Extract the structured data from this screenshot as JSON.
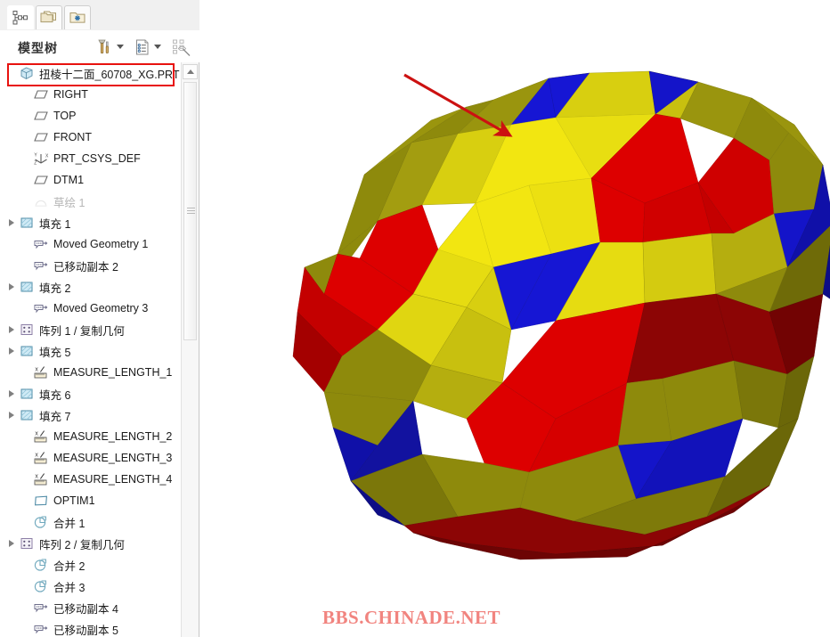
{
  "window": {
    "accent_red": "#e8120f",
    "panel_bg": "#f3f3f3"
  },
  "tabs": [
    {
      "id": "model-tree",
      "icon": "model-tree-icon",
      "label": "",
      "active": true
    },
    {
      "id": "folders",
      "icon": "folder-stack-icon",
      "label": "",
      "active": false
    },
    {
      "id": "favorites",
      "icon": "folder-star-icon",
      "label": "",
      "active": false
    }
  ],
  "tree_header": {
    "title": "模型树",
    "icons": [
      {
        "name": "settings-tools-icon"
      },
      {
        "name": "chevron-down-icon"
      },
      {
        "name": "list-options-icon"
      },
      {
        "name": "chevron-down-icon"
      },
      {
        "name": "filter-tree-icon"
      }
    ]
  },
  "tree": {
    "highlighted_item": "扭棱十二面_60708_XG.PRT",
    "items": [
      {
        "label": "扭棱十二面_60708_XG.PRT",
        "icon": "part-cube-icon",
        "level": 0,
        "expander": false,
        "dim": false,
        "highlight": true
      },
      {
        "label": "RIGHT",
        "icon": "datum-plane-icon",
        "level": 1,
        "expander": false,
        "dim": false
      },
      {
        "label": "TOP",
        "icon": "datum-plane-icon",
        "level": 1,
        "expander": false,
        "dim": false
      },
      {
        "label": "FRONT",
        "icon": "datum-plane-icon",
        "level": 1,
        "expander": false,
        "dim": false
      },
      {
        "label": "PRT_CSYS_DEF",
        "icon": "coord-system-icon",
        "level": 1,
        "expander": false,
        "dim": false
      },
      {
        "label": "DTM1",
        "icon": "datum-plane-icon",
        "level": 1,
        "expander": false,
        "dim": false
      },
      {
        "label": "草绘 1",
        "icon": "sketch-icon",
        "level": 1,
        "expander": false,
        "dim": true
      },
      {
        "label": "填充 1",
        "icon": "fill-surface-icon",
        "level": 1,
        "expander": true,
        "dim": false
      },
      {
        "label": "Moved Geometry 1",
        "icon": "moved-geometry-icon",
        "level": 1,
        "expander": false,
        "dim": false
      },
      {
        "label": "已移动副本 2",
        "icon": "moved-geometry-icon",
        "level": 1,
        "expander": false,
        "dim": false
      },
      {
        "label": "填充 2",
        "icon": "fill-surface-icon",
        "level": 1,
        "expander": true,
        "dim": false
      },
      {
        "label": "Moved Geometry 3",
        "icon": "moved-geometry-icon",
        "level": 1,
        "expander": false,
        "dim": false
      },
      {
        "label": "阵列 1 / 复制几何",
        "icon": "pattern-icon",
        "level": 1,
        "expander": true,
        "dim": false
      },
      {
        "label": "填充 5",
        "icon": "fill-surface-icon",
        "level": 1,
        "expander": true,
        "dim": false
      },
      {
        "label": "MEASURE_LENGTH_1",
        "icon": "measure-length-icon",
        "level": 1,
        "expander": false,
        "dim": false
      },
      {
        "label": "填充 6",
        "icon": "fill-surface-icon",
        "level": 1,
        "expander": true,
        "dim": false
      },
      {
        "label": "填充 7",
        "icon": "fill-surface-icon",
        "level": 1,
        "expander": true,
        "dim": false
      },
      {
        "label": "MEASURE_LENGTH_2",
        "icon": "measure-length-icon",
        "level": 1,
        "expander": false,
        "dim": false
      },
      {
        "label": "MEASURE_LENGTH_3",
        "icon": "measure-length-icon",
        "level": 1,
        "expander": false,
        "dim": false
      },
      {
        "label": "MEASURE_LENGTH_4",
        "icon": "measure-length-icon",
        "level": 1,
        "expander": false,
        "dim": false
      },
      {
        "label": "OPTIM1",
        "icon": "quilt-icon",
        "level": 1,
        "expander": false,
        "dim": false
      },
      {
        "label": "合并 1",
        "icon": "merge-icon",
        "level": 1,
        "expander": false,
        "dim": false
      },
      {
        "label": "阵列 2 / 复制几何",
        "icon": "pattern-icon",
        "level": 1,
        "expander": true,
        "dim": false
      },
      {
        "label": "合并 2",
        "icon": "merge-icon",
        "level": 1,
        "expander": false,
        "dim": false
      },
      {
        "label": "合并 3",
        "icon": "merge-icon",
        "level": 1,
        "expander": false,
        "dim": false
      },
      {
        "label": "已移动副本 4",
        "icon": "moved-geometry-icon",
        "level": 1,
        "expander": false,
        "dim": false
      },
      {
        "label": "已移动副本 5",
        "icon": "moved-geometry-icon",
        "level": 1,
        "expander": false,
        "dim": false
      }
    ]
  },
  "scrollbar": {
    "up_button": "scroll-up-icon",
    "thumb_name": "scroll-thumb"
  },
  "graphics": {
    "model_name": "扭棱十二面体",
    "face_colors": {
      "red_bright": "#dd0000",
      "red_dark": "#8c0505",
      "yellow_bright": "#f2e611",
      "olive": "#8e8a0c",
      "olive_dark": "#6f6b08",
      "blue_bright": "#1616d4",
      "blue_dark": "#0d0d86",
      "background": "#ffffff"
    },
    "annotation": {
      "type": "arrow",
      "color": "#cc1111",
      "points": "from tree root node toward model"
    }
  },
  "watermark": {
    "text": "BBS.CHINADE.NET",
    "color": "#f1847f"
  }
}
